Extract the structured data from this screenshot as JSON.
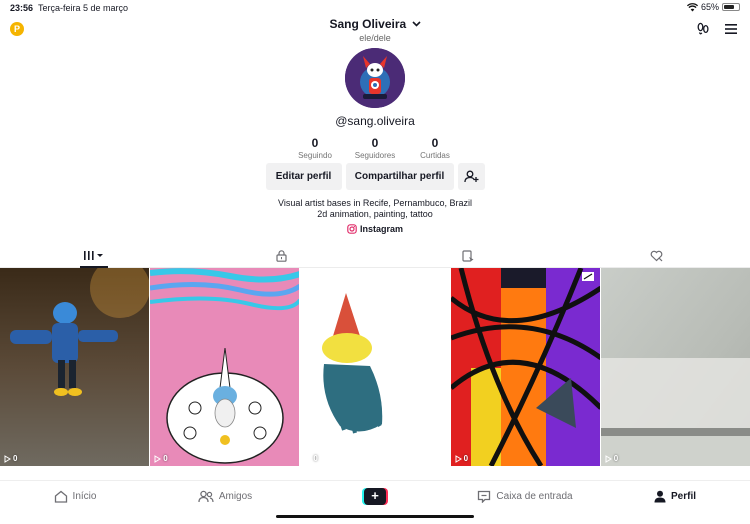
{
  "status_bar": {
    "time": "23:56",
    "date": "Terça-feira 5 de março",
    "battery": "65%"
  },
  "header": {
    "coin_label": "P",
    "display_name": "Sang Oliveira",
    "pronouns": "ele/dele"
  },
  "profile": {
    "handle": "@sang.oliveira",
    "stats": [
      {
        "value": "0",
        "label": "Seguindo"
      },
      {
        "value": "0",
        "label": "Seguidores"
      },
      {
        "value": "0",
        "label": "Curtidas"
      }
    ],
    "edit_label": "Editar perfil",
    "share_label": "Compartilhar perfil",
    "bio_line1": "Visual artist bases in Recife, Pernambuco, Brazil",
    "bio_line2": "2d animation, painting, tattoo",
    "instagram_label": "Instagram"
  },
  "tabs": [
    {
      "icon": "grid-icon",
      "active": true
    },
    {
      "icon": "lock-icon",
      "active": false
    },
    {
      "icon": "tagged-icon",
      "active": false
    },
    {
      "icon": "liked-icon",
      "active": false
    }
  ],
  "videos": [
    {
      "views": "0"
    },
    {
      "views": "0"
    },
    {
      "views": "0"
    },
    {
      "views": "0"
    },
    {
      "views": "0"
    }
  ],
  "bottom_nav": {
    "home": "Início",
    "friends": "Amigos",
    "inbox": "Caixa de entrada",
    "profile": "Perfil"
  },
  "colors": {
    "accent_red": "#fe2c55",
    "accent_cyan": "#25f4ee",
    "text": "#161823"
  }
}
